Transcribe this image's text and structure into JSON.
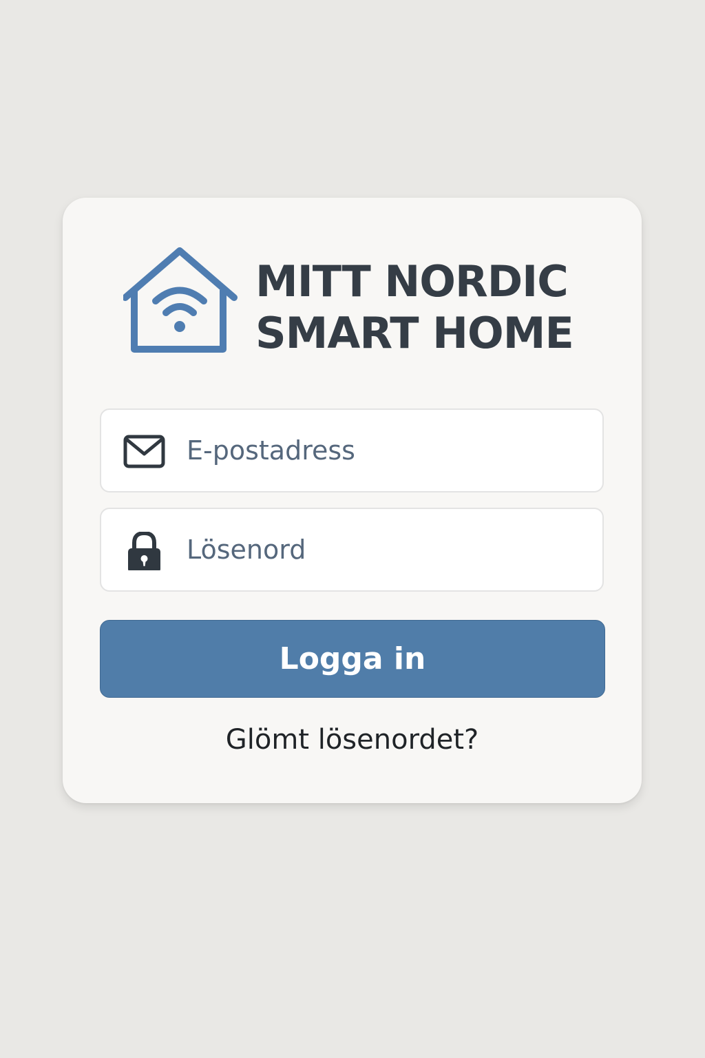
{
  "brand": {
    "line1": "MITT NORDIC",
    "line2": "SMART HOME",
    "logo_icon": "smart-home-wifi-icon",
    "logo_color": "#4f7db1",
    "text_color": "#353d46"
  },
  "form": {
    "email": {
      "placeholder": "E-postadress",
      "value": "",
      "icon": "envelope-icon"
    },
    "password": {
      "placeholder": "Lösenord",
      "value": "",
      "icon": "lock-icon"
    },
    "submit_label": "Logga in",
    "forgot_label": "Glömt lösenordet?"
  },
  "colors": {
    "background": "#e9e8e5",
    "card": "#f8f7f5",
    "accent": "#507da9",
    "placeholder": "#55677c"
  }
}
